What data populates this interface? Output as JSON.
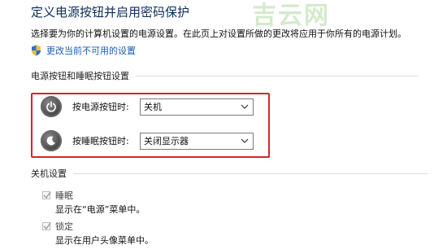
{
  "header": {
    "title": "定义电源按钮并启用密码保护",
    "watermark": "吉云网",
    "description": "选择要为你的计算机设置的电源设置。在此页上对设置所做的更改将应用于你所有的电源计划。"
  },
  "admin_link": {
    "label": "更改当前不可用的设置",
    "icon": "shield-icon"
  },
  "power_section": {
    "title": "电源按钮和睡眠按钮设置",
    "rows": [
      {
        "label": "按电源按钮时:",
        "value": "关机"
      },
      {
        "label": "按睡眠按钮时:",
        "value": "关闭显示器"
      }
    ]
  },
  "shutdown_section": {
    "title": "关机设置",
    "options": [
      {
        "label": "睡眠",
        "checked": true,
        "description": "显示在“电源”菜单中。"
      },
      {
        "label": "锁定",
        "checked": true,
        "description": "显示在用户头像菜单中。"
      }
    ]
  },
  "colors": {
    "title": "#0b2d5a",
    "link": "#1a5fb4",
    "highlight_border": "#d8232a",
    "watermark": "#c7e3bb"
  }
}
